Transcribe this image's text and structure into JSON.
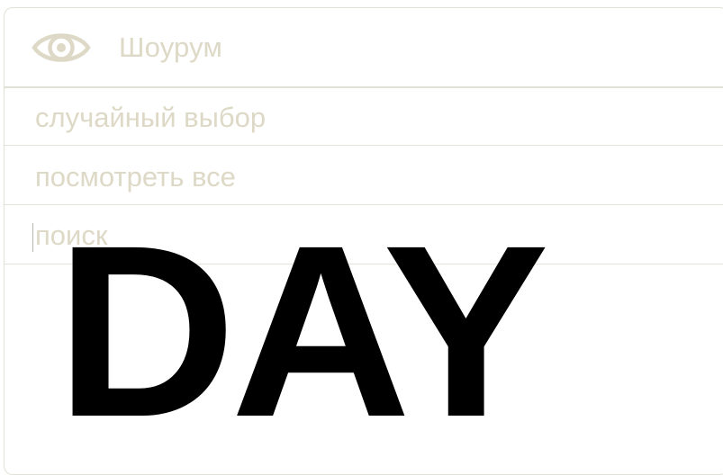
{
  "header": {
    "icon": "eye-icon",
    "title": "Шоурум"
  },
  "menu": {
    "random_label": "случайный выбор",
    "all_label": "посмотреть все",
    "search_placeholder": "поиск",
    "search_value": ""
  },
  "overlay": {
    "text": "DAY"
  },
  "colors": {
    "border": "#e2e1d6",
    "muted_text": "#ddd9c6",
    "overlay_text": "#000000",
    "background": "#ffffff"
  }
}
